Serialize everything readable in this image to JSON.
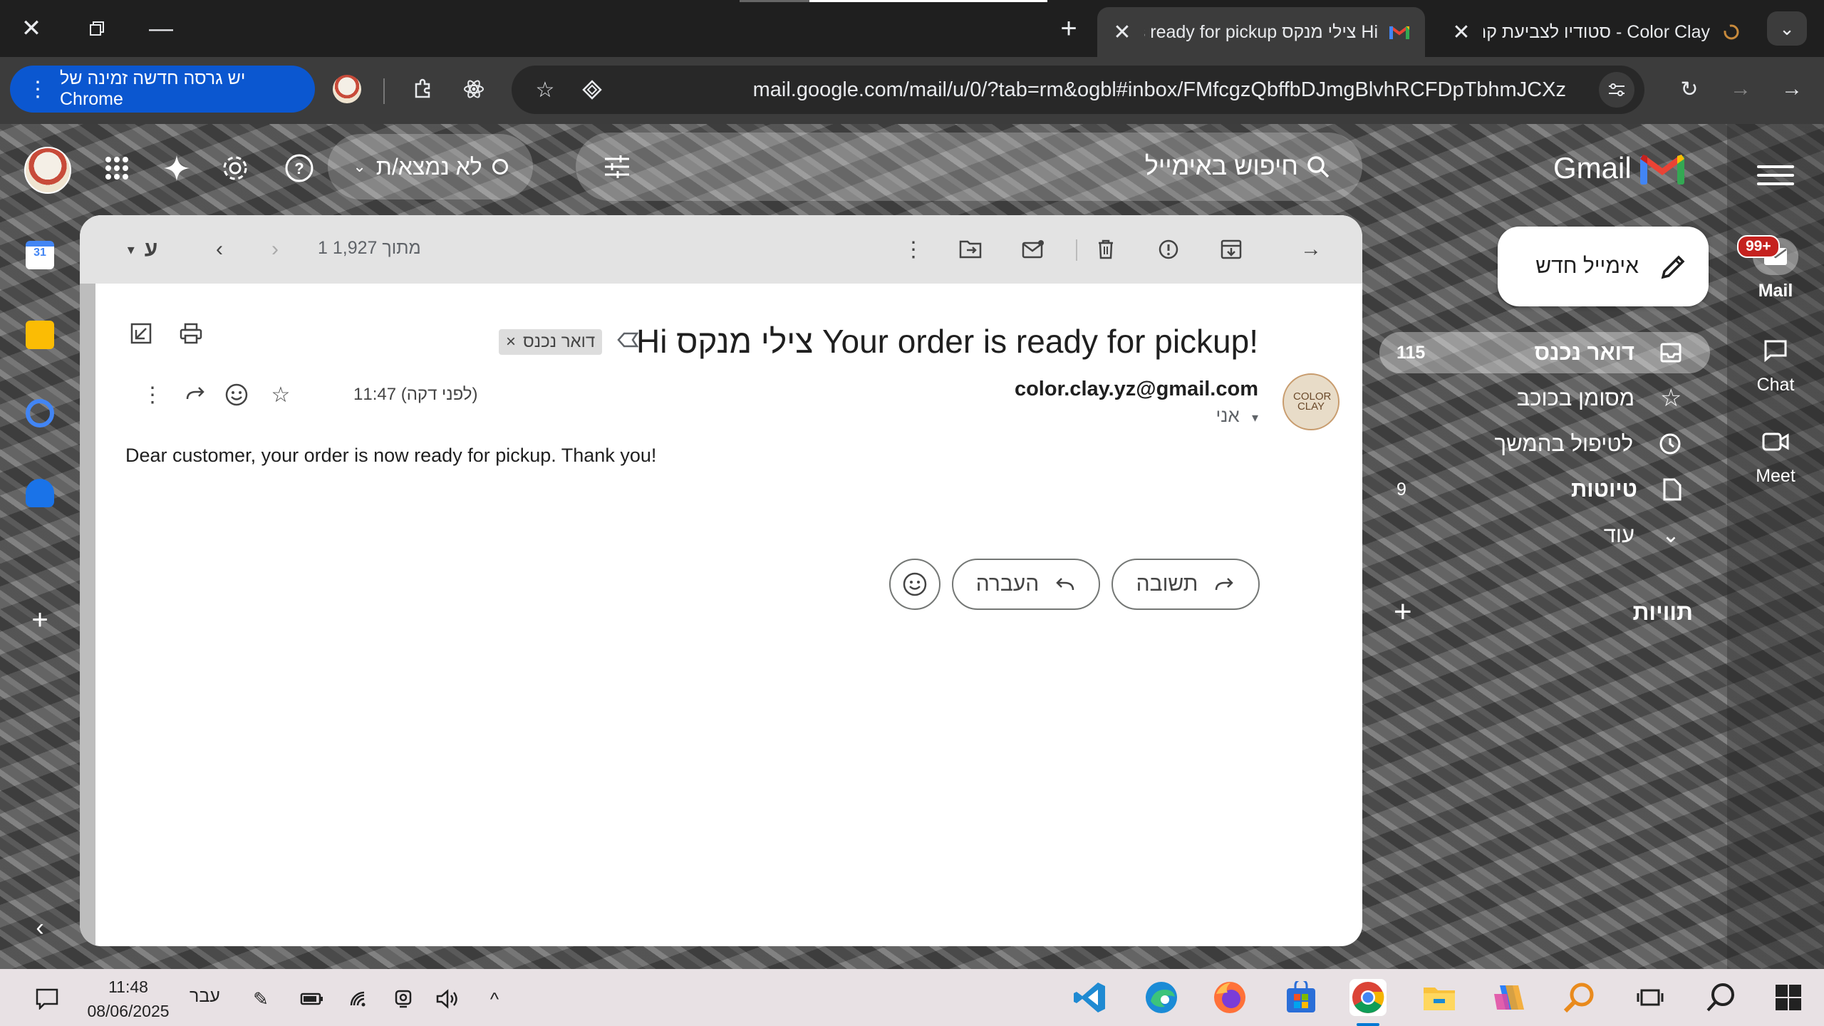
{
  "browser": {
    "tabs": [
      {
        "title": "Hi צילי מנקס Your order is ready for pickup!",
        "active": true,
        "favicon": "gmail-icon"
      },
      {
        "title": "Color Clay - סטודיו לצביעת קרמיקה",
        "active": false,
        "favicon": "loading-icon"
      }
    ],
    "update_label": "יש גרסה חדשה זמינה של Chrome",
    "url": "mail.google.com/mail/u/0/?tab=rm&ogbl#inbox/FMfcgzQbffbDJmgBlvhRCFDpTbhmJCXz"
  },
  "gmail": {
    "logo_text": "Gmail",
    "search_placeholder": "חיפוש באימייל",
    "status": "לא נמצא/ת",
    "compose": "אימייל חדש",
    "rail": {
      "mail": "Mail",
      "chat": "Chat",
      "meet": "Meet",
      "badge": "99+"
    },
    "nav": [
      {
        "label": "דואר נכנס",
        "count": "115",
        "icon": "inbox-icon",
        "active": true
      },
      {
        "label": "מסומן בכוכב",
        "count": "",
        "icon": "star-icon",
        "active": false
      },
      {
        "label": "לטיפול בהמשך",
        "count": "",
        "icon": "clock-icon",
        "active": false
      },
      {
        "label": "טיוטות",
        "count": "9",
        "icon": "draft-icon",
        "active": false
      },
      {
        "label": "עוד",
        "count": "",
        "icon": "chevron-down-icon",
        "active": false
      }
    ],
    "labels_heading": "תוויות",
    "toolbar": {
      "counter": "1 מתוך 1,927",
      "lang_letter": "ע"
    },
    "message": {
      "subject": "Hi צילי מנקס Your order is ready for pickup!",
      "label_chip": "דואר נכנס",
      "sender": "color.clay.yz@gmail.com",
      "to": "אני",
      "time": "11:47 (לפני דקה)",
      "avatar_text": "COLOR CLAY",
      "body": "Dear customer, your order is now ready for pickup. Thank you!",
      "reply": "תשובה",
      "forward": "העברה"
    }
  },
  "taskbar": {
    "time": "11:48",
    "date": "08/06/2025",
    "language": "עבר"
  },
  "colors": {
    "accent": "#0b57d0",
    "badge": "#c5221f"
  }
}
